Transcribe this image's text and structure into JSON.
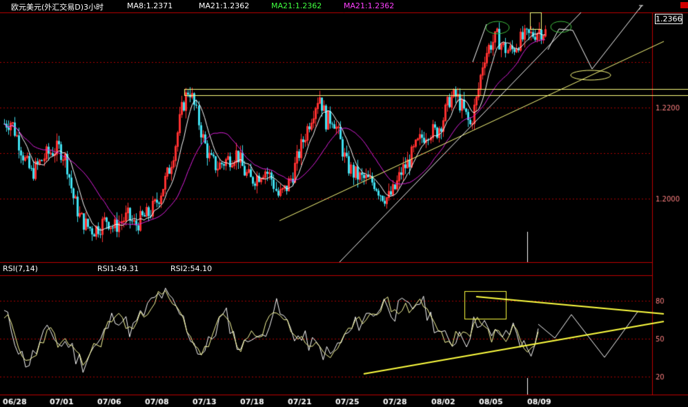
{
  "header": {
    "symbol": "欧元美元(外汇交易D)3小时",
    "ma1": "MA8:1.2371",
    "ma2": "MA21:1.2362",
    "ma3": "MA21:1.2362",
    "ma4": "MA21:1.2362"
  },
  "current_price": "1.2366",
  "rsi_header": {
    "title": "RSI(7,14)",
    "rsi1": "RSI1:49.31",
    "rsi2": "RSI2:54.10"
  },
  "colors": {
    "bull": "#ff3030",
    "bear": "#40e0f0",
    "ma_fast": "#ffffff",
    "ma_slow": "#e020e0",
    "trendline": "#ffff80",
    "rsi_fast": "#ffffa0",
    "rsi_slow": "#ffffff",
    "rsi_trend": "#ffff40",
    "grid": "#b00000",
    "ma2_text": "#ffffff",
    "ma3_text": "#40ff40",
    "ma4_text": "#ff40ff"
  },
  "chart_data": [
    {
      "type": "candlestick",
      "title": "欧元美元(外汇交易D)3小时",
      "yticks": [
        "1.2000",
        "1.2200"
      ],
      "xticks": [
        "06/28",
        "07/01",
        "07/06",
        "07/08",
        "07/13",
        "07/18",
        "07/21",
        "07/25",
        "07/28",
        "08/02",
        "08/05",
        "08/09"
      ],
      "series": [
        {
          "name": "MA8",
          "value": 1.2371
        },
        {
          "name": "MA21",
          "value": 1.2362
        }
      ],
      "close_path": [
        1.2165,
        1.217,
        1.213,
        1.2085,
        1.2055,
        1.2075,
        1.2095,
        1.2105,
        1.211,
        1.2085,
        1.2005,
        1.196,
        1.194,
        1.193,
        1.194,
        1.1955,
        1.1935,
        1.195,
        1.196,
        1.194,
        1.1955,
        1.1965,
        1.1985,
        1.202,
        1.206,
        1.212,
        1.22,
        1.2245,
        1.219,
        1.213,
        1.2085,
        1.207,
        1.208,
        1.209,
        1.21,
        1.206,
        1.204,
        1.205,
        1.2065,
        1.2045,
        1.2005,
        1.202,
        1.205,
        1.21,
        1.2145,
        1.219,
        1.223,
        1.217,
        1.218,
        1.213,
        1.2075,
        1.2055,
        1.2045,
        1.204,
        1.2035,
        1.201,
        1.2,
        1.202,
        1.206,
        1.208,
        1.211,
        1.2135,
        1.215,
        1.2145,
        1.2175,
        1.222,
        1.2225,
        1.2195,
        1.216,
        1.222,
        1.231,
        1.234,
        1.2355,
        1.233,
        1.2325,
        1.2345,
        1.2355,
        1.236,
        1.2372,
        1.2366
      ]
    },
    {
      "type": "line",
      "title": "RSI(7,14)",
      "yticks": [
        "20",
        "50",
        "80"
      ],
      "series": [
        {
          "name": "RSI1",
          "value": 49.31
        },
        {
          "name": "RSI2",
          "value": 54.1
        }
      ],
      "rsi_path": [
        70,
        58,
        38,
        30,
        40,
        52,
        56,
        44,
        48,
        36,
        30,
        42,
        46,
        60,
        70,
        64,
        56,
        66,
        74,
        82,
        86,
        78,
        70,
        58,
        44,
        38,
        50,
        64,
        68,
        48,
        42,
        56,
        46,
        62,
        76,
        66,
        58,
        50,
        48,
        44,
        40,
        36,
        46,
        52,
        60,
        66,
        70,
        74,
        80,
        70,
        76,
        72,
        82,
        72,
        62,
        52,
        44,
        56,
        50,
        62,
        68,
        48,
        56,
        50,
        62,
        44,
        40,
        52
      ]
    }
  ]
}
